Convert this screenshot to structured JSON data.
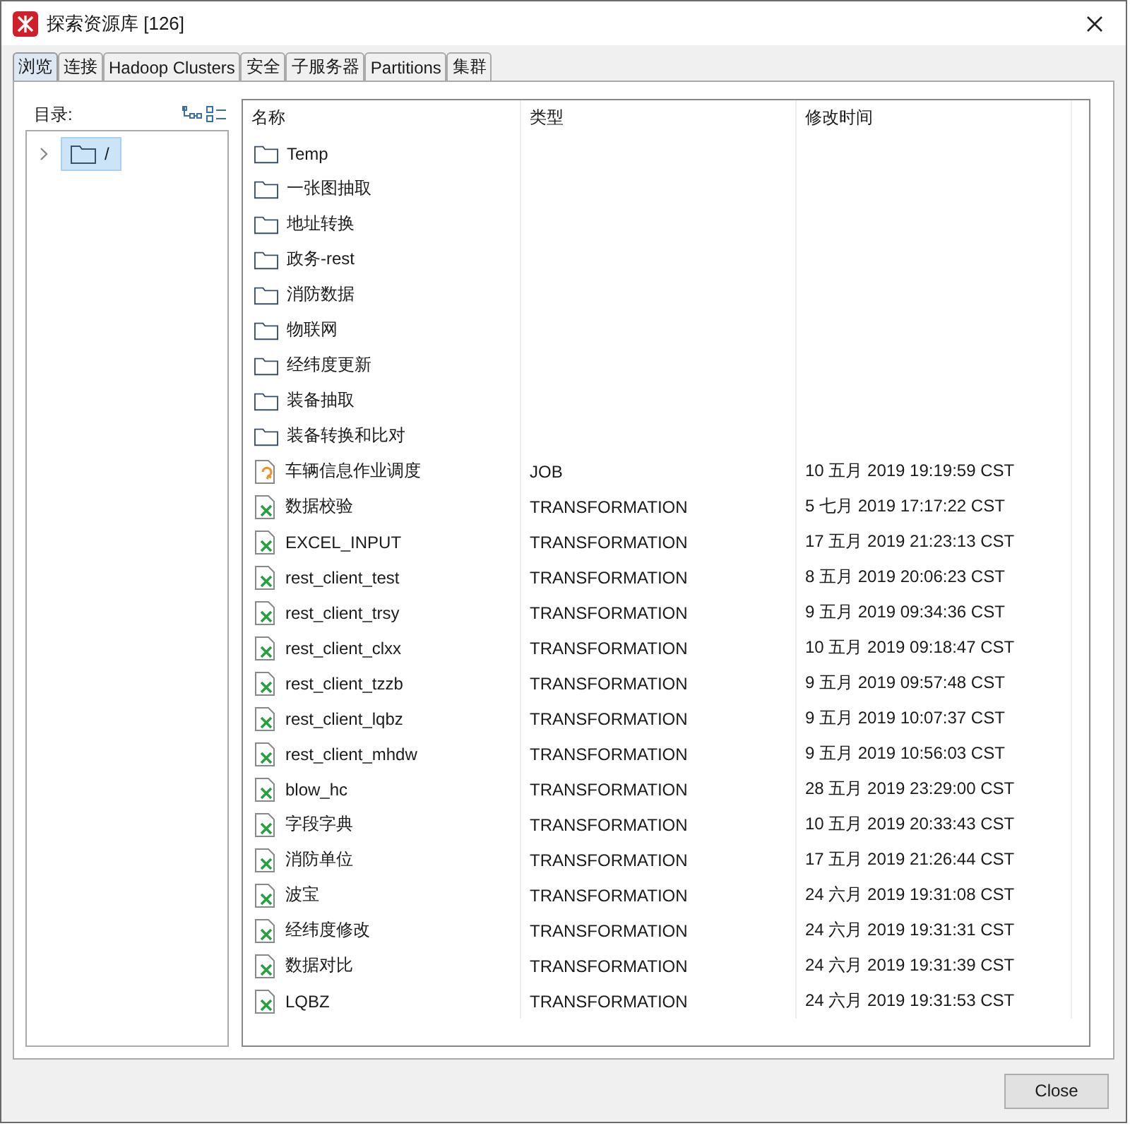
{
  "window": {
    "title": "探索资源库 [126]"
  },
  "tabs": [
    {
      "label": "浏览",
      "selected": true
    },
    {
      "label": "连接",
      "selected": false
    },
    {
      "label": "Hadoop Clusters",
      "selected": false
    },
    {
      "label": "安全",
      "selected": false
    },
    {
      "label": "子服务器",
      "selected": false
    },
    {
      "label": "Partitions",
      "selected": false
    },
    {
      "label": "集群",
      "selected": false
    }
  ],
  "sidebar": {
    "label": "目录:",
    "tree": [
      {
        "label": "/",
        "selected": true,
        "expanded": false
      }
    ]
  },
  "table": {
    "columns": [
      "名称",
      "类型",
      "修改时间"
    ],
    "rows": [
      {
        "kind": "folder",
        "name": "Temp"
      },
      {
        "kind": "folder",
        "name": "一张图抽取"
      },
      {
        "kind": "folder",
        "name": "地址转换"
      },
      {
        "kind": "folder",
        "name": "政务-rest"
      },
      {
        "kind": "folder",
        "name": "消防数据"
      },
      {
        "kind": "folder",
        "name": "物联网"
      },
      {
        "kind": "folder",
        "name": "经纬度更新"
      },
      {
        "kind": "folder",
        "name": "装备抽取"
      },
      {
        "kind": "folder",
        "name": "装备转换和比对"
      },
      {
        "kind": "job",
        "name": "车辆信息作业调度",
        "type": "JOB",
        "modified": "10 五月 2019 19:19:59 CST"
      },
      {
        "kind": "transformation",
        "name": "数据校验",
        "type": "TRANSFORMATION",
        "modified": "5 七月 2019 17:17:22 CST"
      },
      {
        "kind": "transformation",
        "name": "EXCEL_INPUT",
        "type": "TRANSFORMATION",
        "modified": "17 五月 2019 21:23:13 CST"
      },
      {
        "kind": "transformation",
        "name": "rest_client_test",
        "type": "TRANSFORMATION",
        "modified": "8 五月 2019 20:06:23 CST"
      },
      {
        "kind": "transformation",
        "name": "rest_client_trsy",
        "type": "TRANSFORMATION",
        "modified": "9 五月 2019 09:34:36 CST"
      },
      {
        "kind": "transformation",
        "name": "rest_client_clxx",
        "type": "TRANSFORMATION",
        "modified": "10 五月 2019 09:18:47 CST"
      },
      {
        "kind": "transformation",
        "name": "rest_client_tzzb",
        "type": "TRANSFORMATION",
        "modified": "9 五月 2019 09:57:48 CST"
      },
      {
        "kind": "transformation",
        "name": "rest_client_lqbz",
        "type": "TRANSFORMATION",
        "modified": "9 五月 2019 10:07:37 CST"
      },
      {
        "kind": "transformation",
        "name": "rest_client_mhdw",
        "type": "TRANSFORMATION",
        "modified": "9 五月 2019 10:56:03 CST"
      },
      {
        "kind": "transformation",
        "name": "blow_hc",
        "type": "TRANSFORMATION",
        "modified": "28 五月 2019 23:29:00 CST"
      },
      {
        "kind": "transformation",
        "name": "字段字典",
        "type": "TRANSFORMATION",
        "modified": "10 五月 2019 20:33:43 CST"
      },
      {
        "kind": "transformation",
        "name": "消防单位",
        "type": "TRANSFORMATION",
        "modified": "17 五月 2019 21:26:44 CST"
      },
      {
        "kind": "transformation",
        "name": "波宝",
        "type": "TRANSFORMATION",
        "modified": "24 六月 2019 19:31:08 CST"
      },
      {
        "kind": "transformation",
        "name": "经纬度修改",
        "type": "TRANSFORMATION",
        "modified": "24 六月 2019 19:31:31 CST"
      },
      {
        "kind": "transformation",
        "name": "数据对比",
        "type": "TRANSFORMATION",
        "modified": "24 六月 2019 19:31:39 CST"
      },
      {
        "kind": "transformation",
        "name": "LQBZ",
        "type": "TRANSFORMATION",
        "modified": "24 六月 2019 19:31:53 CST"
      }
    ]
  },
  "buttons": [
    "Close"
  ]
}
